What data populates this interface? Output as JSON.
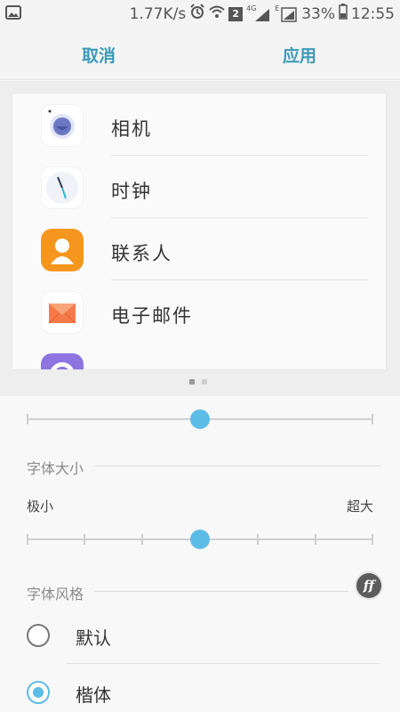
{
  "status_bar": {
    "speed": "1.77K/s",
    "sim_label": "2",
    "network_4g": "4G",
    "network_e": "E",
    "battery": "33%",
    "time": "12:55",
    "icons": [
      "image-icon",
      "alarm-icon",
      "wifi-icon",
      "sim-icon",
      "signal-icon",
      "battery-icon"
    ]
  },
  "action_bar": {
    "cancel": "取消",
    "apply": "应用",
    "accent_color": "#3d9ab8"
  },
  "preview": {
    "apps": [
      {
        "label": "相机",
        "icon": "camera-icon"
      },
      {
        "label": "时钟",
        "icon": "clock-icon"
      },
      {
        "label": "联系人",
        "icon": "contacts-icon"
      },
      {
        "label": "电子邮件",
        "icon": "email-icon"
      },
      {
        "label": "",
        "icon": "app-icon-partial"
      }
    ],
    "page_count": 2,
    "active_page": 1
  },
  "settings": {
    "zoom_slider": {
      "value": 0.5
    },
    "font_size": {
      "title": "字体大小",
      "min_label": "极小",
      "max_label": "超大",
      "steps": 7,
      "value_step": 4
    },
    "font_style": {
      "title": "字体风格",
      "badge": "ff",
      "options": [
        {
          "label": "默认",
          "checked": false
        },
        {
          "label": "楷体",
          "checked": true
        }
      ]
    },
    "slider_color": "#5dbce6"
  }
}
